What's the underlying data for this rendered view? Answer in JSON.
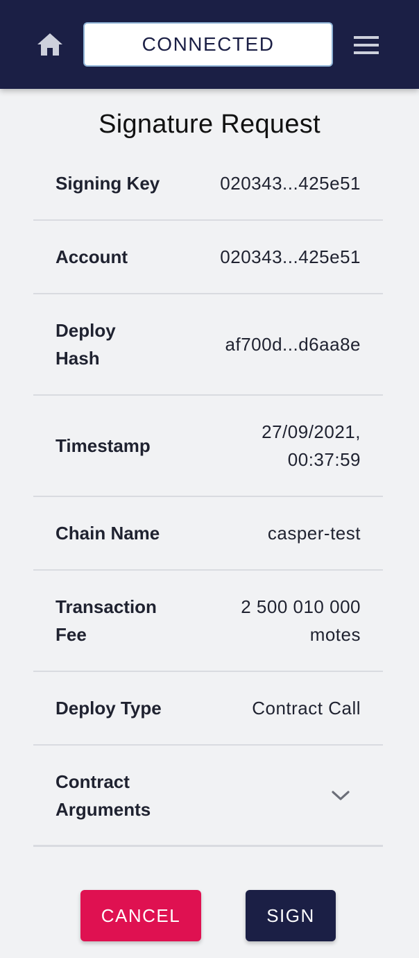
{
  "header": {
    "status_label": "CONNECTED",
    "home_icon": "home-icon",
    "menu_icon": "hamburger-menu-icon"
  },
  "page": {
    "title": "Signature Request"
  },
  "details": {
    "signing_key": {
      "label": "Signing Key",
      "value": "020343...425e51"
    },
    "account": {
      "label": "Account",
      "value": "020343...425e51"
    },
    "deploy_hash": {
      "label": "Deploy Hash",
      "value": "af700d...d6aa8e"
    },
    "timestamp": {
      "label": "Timestamp",
      "value": "27/09/2021, 00:37:59"
    },
    "chain_name": {
      "label": "Chain Name",
      "value": "casper-test"
    },
    "transaction_fee": {
      "label": "Transaction Fee",
      "value": "2 500 010 000 motes"
    },
    "deploy_type": {
      "label": "Deploy Type",
      "value": "Contract Call"
    },
    "contract_arguments": {
      "label": "Contract Arguments",
      "expand_icon": "chevron-down-icon"
    }
  },
  "actions": {
    "cancel_label": "CANCEL",
    "sign_label": "SIGN"
  },
  "colors": {
    "header_bg": "#1b1f45",
    "cancel_bg": "#df1151",
    "sign_bg": "#1b1f45",
    "page_bg": "#f1f2f4"
  }
}
